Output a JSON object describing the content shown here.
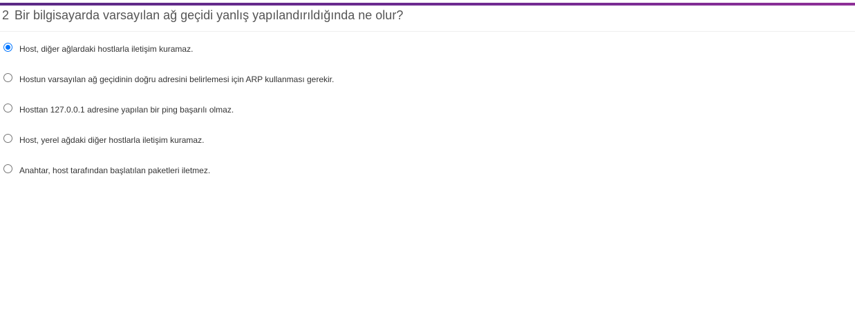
{
  "accent_color": "#6f2a91",
  "selected_color": "#0075ff",
  "question": {
    "number": "2",
    "text": "Bir bilgisayarda varsayılan ağ geçidi yanlış yapılandırıldığında ne olur?"
  },
  "options": [
    {
      "label": "Host, diğer ağlardaki hostlarla iletişim kuramaz.",
      "selected": true
    },
    {
      "label": "Hostun varsayılan ağ geçidinin doğru adresini belirlemesi için ARP kullanması gerekir.",
      "selected": false
    },
    {
      "label": "Hosttan 127.0.0.1 adresine yapılan bir ping başarılı olmaz.",
      "selected": false
    },
    {
      "label": "Host, yerel ağdaki diğer hostlarla iletişim kuramaz.",
      "selected": false
    },
    {
      "label": "Anahtar, host tarafından başlatılan paketleri iletmez.",
      "selected": false
    }
  ]
}
